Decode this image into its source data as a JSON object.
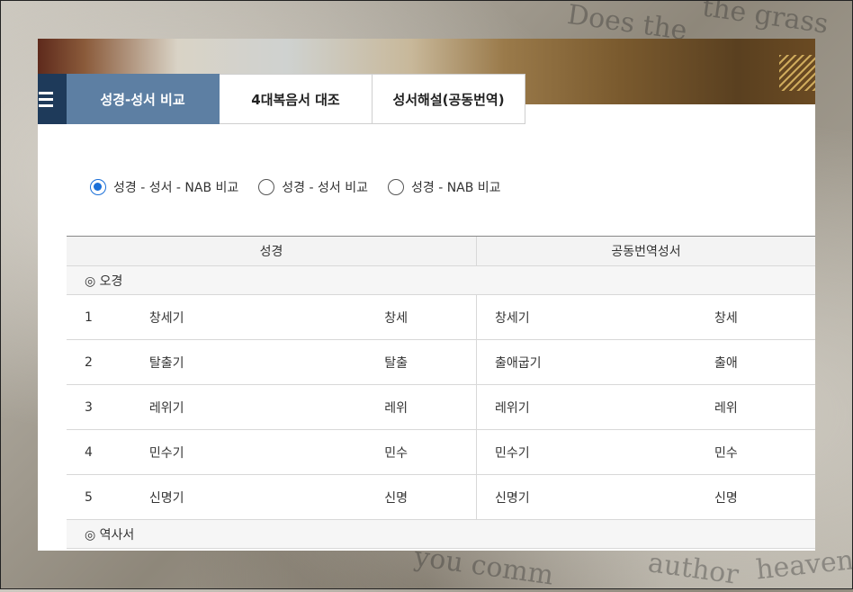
{
  "background_text": [
    "Does the",
    "the grass",
    "you comm",
    "author",
    "heavens"
  ],
  "tabs": [
    {
      "label": "성경-성서 비교",
      "active": true
    },
    {
      "label": "4대복음서 대조",
      "active": false
    },
    {
      "label": "성서해설(공동번역)",
      "active": false
    }
  ],
  "radios": [
    {
      "label": "성경 - 성서 - NAB 비교",
      "checked": true
    },
    {
      "label": "성경 - 성서 비교",
      "checked": false
    },
    {
      "label": "성경 - NAB 비교",
      "checked": false
    }
  ],
  "table": {
    "headers": [
      "성경",
      "공동번역성서"
    ],
    "section1": "◎ 오경",
    "rows": [
      {
        "num": "1",
        "name": "창세기",
        "abbr": "창세",
        "rname": "창세기",
        "rabbr": "창세"
      },
      {
        "num": "2",
        "name": "탈출기",
        "abbr": "탈출",
        "rname": "출애굽기",
        "rabbr": "출애"
      },
      {
        "num": "3",
        "name": "레위기",
        "abbr": "레위",
        "rname": "레위기",
        "rabbr": "레위"
      },
      {
        "num": "4",
        "name": "민수기",
        "abbr": "민수",
        "rname": "민수기",
        "rabbr": "민수"
      },
      {
        "num": "5",
        "name": "신명기",
        "abbr": "신명",
        "rname": "신명기",
        "rabbr": "신명"
      }
    ],
    "section2": "◎ 역사서"
  },
  "colors": {
    "active_tab": "#5d7fa3",
    "menu_button": "#1e3a5a",
    "radio_checked": "#1a6fd8"
  }
}
